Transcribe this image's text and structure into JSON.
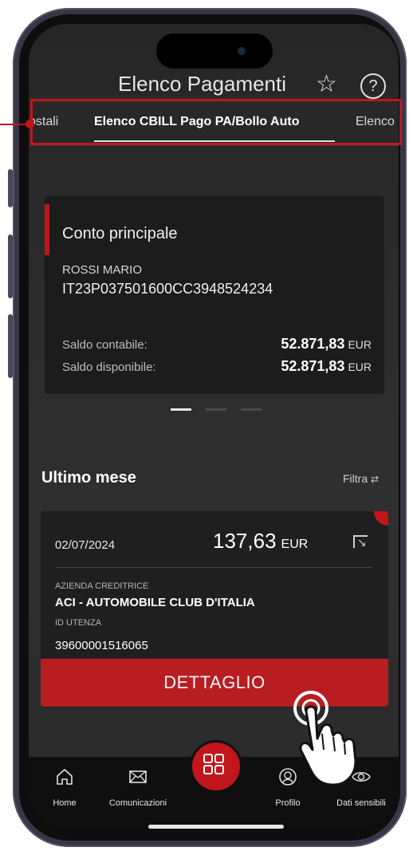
{
  "header": {
    "title": "Elenco Pagamenti",
    "star_icon": "star-outline-icon",
    "help_icon": "question-circle-icon"
  },
  "tabs": [
    {
      "label": "ostali",
      "active": false
    },
    {
      "label": "Elenco CBILL Pago PA/Bollo Auto",
      "active": true
    },
    {
      "label": "Elenco",
      "active": false
    }
  ],
  "account": {
    "name": "Conto principale",
    "holder": "ROSSI MARIO",
    "iban": "IT23P037501600CC3948524234",
    "saldo_contabile_label": "Saldo contabile:",
    "saldo_contabile_value": "52.871,83",
    "saldo_disponibile_label": "Saldo disponibile:",
    "saldo_disponibile_value": "52.871,83",
    "currency": "EUR"
  },
  "carousel": {
    "pages": 3,
    "active": 0
  },
  "section": {
    "title": "Ultimo mese",
    "filter_label": "Filtra"
  },
  "payment": {
    "date": "02/07/2024",
    "amount": "137,63",
    "currency": "EUR",
    "creditor_label": "AZIENDA CREDITRICE",
    "creditor": "ACI - AUTOMOBILE CLUB D'ITALIA",
    "user_id_label": "ID UTENZA",
    "user_id": "39600001516065",
    "detail_button": "DETTAGLIO"
  },
  "nav": {
    "home": "Home",
    "comunicazioni": "Comunicazioni",
    "profilo": "Profilo",
    "dati_sensibili": "Dati sensibili"
  },
  "colors": {
    "accent": "#c0161c",
    "background": "#2a2a2a",
    "card": "#1f1f1f"
  }
}
